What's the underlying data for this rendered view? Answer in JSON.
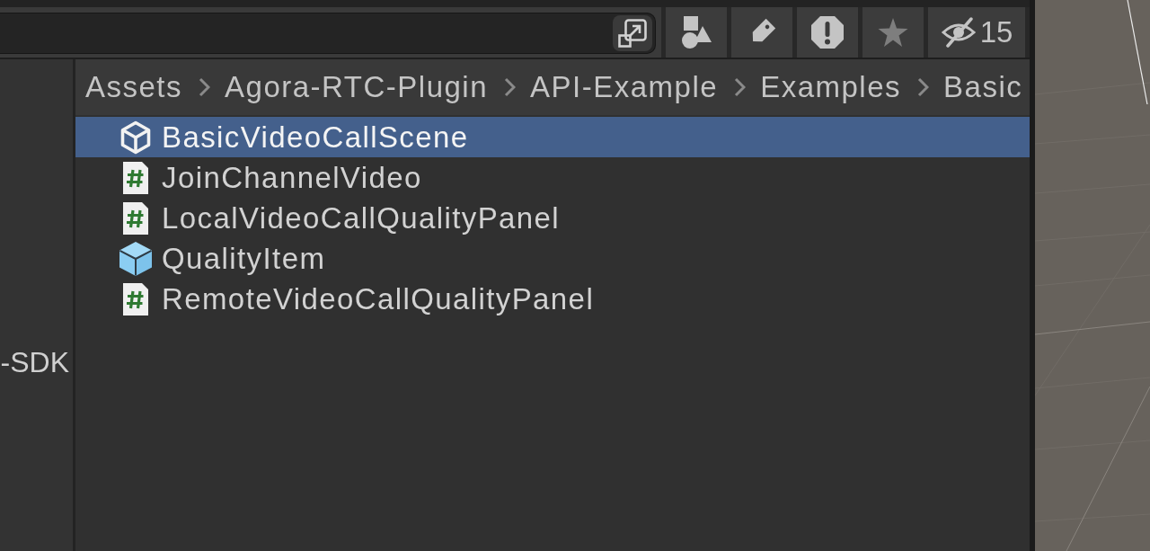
{
  "toolbar": {
    "buttons": [
      {
        "kind": "types",
        "disabled": false
      },
      {
        "kind": "labels",
        "disabled": false
      },
      {
        "kind": "alerts",
        "disabled": false
      },
      {
        "kind": "favorite",
        "disabled": true
      },
      {
        "kind": "hidden",
        "disabled": false,
        "count": "15"
      }
    ]
  },
  "folder_tree": {
    "items": [
      {
        "label": "-SDK"
      }
    ]
  },
  "breadcrumbs": [
    "Assets",
    "Agora-RTC-Plugin",
    "API-Example",
    "Examples",
    "Basic"
  ],
  "files": [
    {
      "name": "BasicVideoCallScene",
      "kind": "scene",
      "selected": true
    },
    {
      "name": "JoinChannelVideo",
      "kind": "script",
      "selected": false
    },
    {
      "name": "LocalVideoCallQualityPanel",
      "kind": "script",
      "selected": false
    },
    {
      "name": "QualityItem",
      "kind": "prefab",
      "selected": false
    },
    {
      "name": "RemoteVideoCallQualityPanel",
      "kind": "script",
      "selected": false
    }
  ]
}
